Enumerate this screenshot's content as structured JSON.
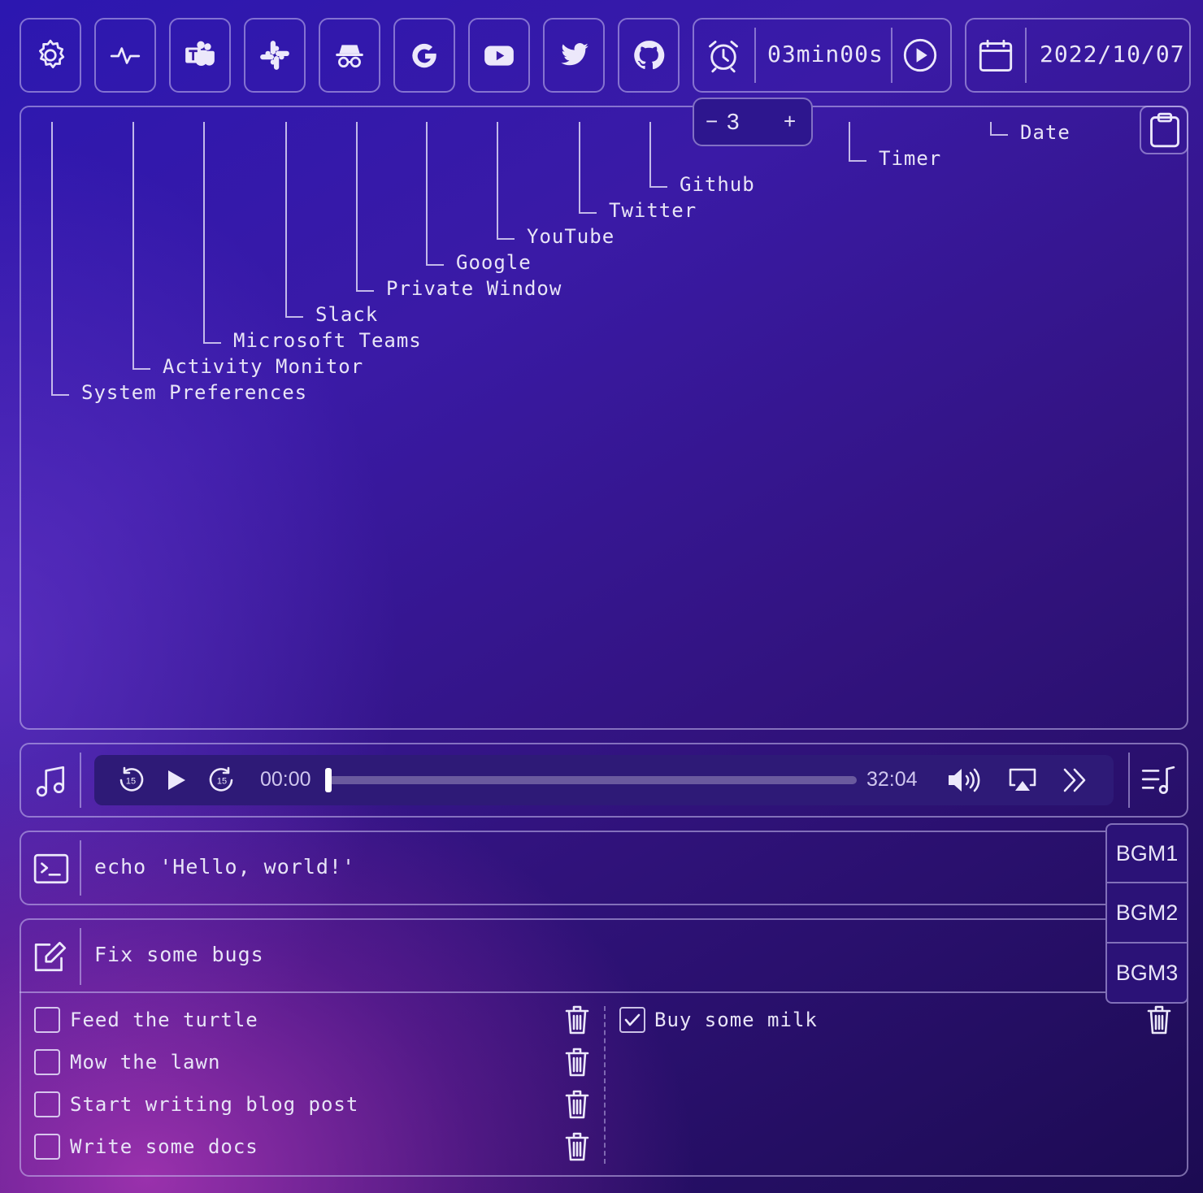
{
  "toolbar": {
    "apps": [
      {
        "icon": "gear-icon",
        "label": "System Preferences"
      },
      {
        "icon": "activity-icon",
        "label": "Activity Monitor"
      },
      {
        "icon": "teams-icon",
        "label": "Microsoft Teams"
      },
      {
        "icon": "slack-icon",
        "label": "Slack"
      },
      {
        "icon": "incognito-icon",
        "label": "Private Window"
      },
      {
        "icon": "google-icon",
        "label": "Google"
      },
      {
        "icon": "youtube-icon",
        "label": "YouTube"
      },
      {
        "icon": "twitter-icon",
        "label": "Twitter"
      },
      {
        "icon": "github-icon",
        "label": "Github"
      }
    ],
    "timer": {
      "value": "03min00s",
      "stepper_value": "3",
      "minus": "−",
      "plus": "+"
    },
    "date": {
      "value": "2022/10/07"
    }
  },
  "tree_labels": {
    "system_preferences": "System Preferences",
    "activity_monitor": "Activity Monitor",
    "microsoft_teams": "Microsoft Teams",
    "slack": "Slack",
    "private_window": "Private Window",
    "google": "Google",
    "youtube": "YouTube",
    "twitter": "Twitter",
    "github": "Github",
    "timer": "Timer",
    "date": "Date"
  },
  "player": {
    "current_time": "00:00",
    "duration": "32:04",
    "progress": 0,
    "skip_back": "15",
    "skip_forward": "15"
  },
  "bgm_menu": [
    "BGM1",
    "BGM2",
    "BGM3"
  ],
  "terminal": {
    "command": "echo 'Hello, world!'"
  },
  "todo_input": {
    "value": "Fix some bugs"
  },
  "todos": {
    "pending": [
      {
        "text": "Feed the turtle",
        "done": false
      },
      {
        "text": "Mow the lawn",
        "done": false
      },
      {
        "text": "Start writing blog post",
        "done": false
      },
      {
        "text": "Write some docs",
        "done": false
      }
    ],
    "completed": [
      {
        "text": "Buy some milk",
        "done": true
      }
    ]
  },
  "colors": {
    "accent": "#ece8fb",
    "border": "#c8bef0",
    "player_bg": "#2e1a77"
  }
}
